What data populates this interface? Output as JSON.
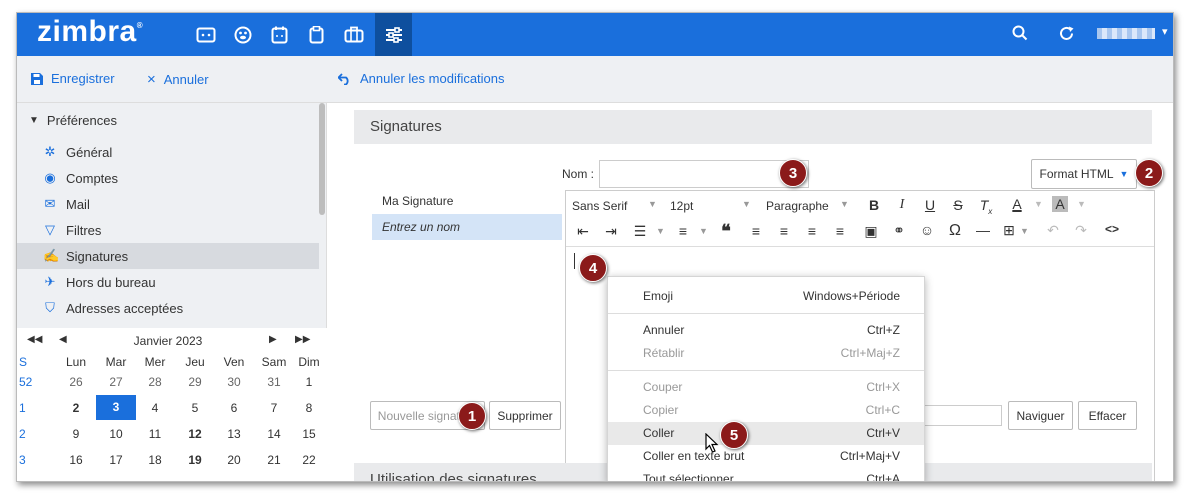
{
  "app": {
    "logo": "zimbra",
    "logo_mark": "®"
  },
  "topbar": {
    "apps": [
      {
        "name": "mail",
        "icon": "envelope-icon"
      },
      {
        "name": "contacts",
        "icon": "contacts-icon"
      },
      {
        "name": "calendar",
        "icon": "calendar-icon"
      },
      {
        "name": "tasks",
        "icon": "tasks-icon"
      },
      {
        "name": "briefcase",
        "icon": "briefcase-icon"
      },
      {
        "name": "preferences",
        "icon": "sliders-icon"
      }
    ]
  },
  "toolbar": {
    "save": "Enregistrer",
    "cancel": "Annuler",
    "undo": "Annuler les modifications"
  },
  "sidebar": {
    "header": "Préférences",
    "items": [
      "Général",
      "Comptes",
      "Mail",
      "Filtres",
      "Signatures",
      "Hors du bureau",
      "Adresses acceptées"
    ],
    "selected": "Signatures"
  },
  "calendar": {
    "month": "Janvier 2023",
    "weekday_headers": [
      "S",
      "Lun",
      "Mar",
      "Mer",
      "Jeu",
      "Ven",
      "Sam",
      "Dim"
    ],
    "weeks": [
      {
        "wk": "52",
        "days": [
          "26",
          "27",
          "28",
          "29",
          "30",
          "31",
          "1"
        ]
      },
      {
        "wk": "1",
        "days": [
          "2",
          "3",
          "4",
          "5",
          "6",
          "7",
          "8"
        ]
      },
      {
        "wk": "2",
        "days": [
          "9",
          "10",
          "11",
          "12",
          "13",
          "14",
          "15"
        ]
      },
      {
        "wk": "3",
        "days": [
          "16",
          "17",
          "18",
          "19",
          "20",
          "21",
          "22"
        ]
      }
    ],
    "today": "3"
  },
  "signatures": {
    "section_title": "Signatures",
    "name_label": "Nom :",
    "name_value": "",
    "format_button": "Format HTML",
    "list": [
      "Ma Signature",
      "Entrez un nom"
    ],
    "new_button": "Nouvelle signature",
    "delete_button": "Supprimer",
    "browse_button": "Naviguer",
    "clear_button": "Effacer"
  },
  "editor": {
    "font": "Sans Serif",
    "size": "12pt",
    "block": "Paragraphe"
  },
  "usage": {
    "section_title": "Utilisation des signatures"
  },
  "context_menu": {
    "items": [
      {
        "label": "Emoji",
        "shortcut": "Windows+Période",
        "disabled": false
      },
      {
        "label": "Annuler",
        "shortcut": "Ctrl+Z",
        "disabled": false
      },
      {
        "label": "Rétablir",
        "shortcut": "Ctrl+Maj+Z",
        "disabled": true
      },
      {
        "label": "Couper",
        "shortcut": "Ctrl+X",
        "disabled": true
      },
      {
        "label": "Copier",
        "shortcut": "Ctrl+C",
        "disabled": true
      },
      {
        "label": "Coller",
        "shortcut": "Ctrl+V",
        "disabled": false
      },
      {
        "label": "Coller en texte brut",
        "shortcut": "Ctrl+Maj+V",
        "disabled": false
      },
      {
        "label": "Tout sélectionner",
        "shortcut": "Ctrl+A",
        "disabled": false
      }
    ]
  },
  "markers": [
    "1",
    "2",
    "3",
    "4",
    "5"
  ]
}
